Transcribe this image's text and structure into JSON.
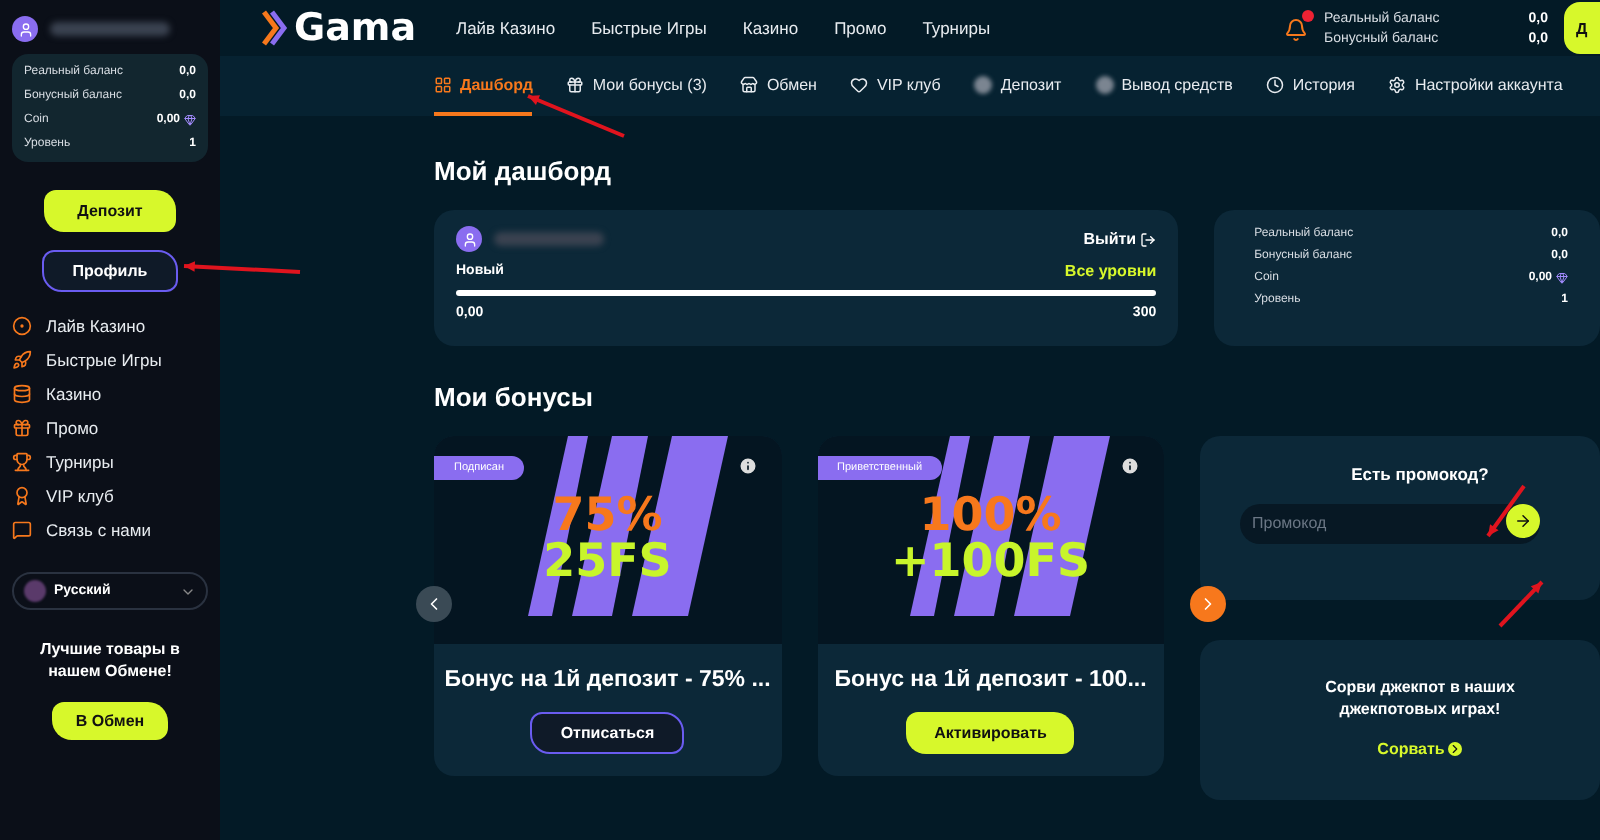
{
  "sidebar": {
    "balances": [
      {
        "label": "Реальный баланс",
        "value": "0,0",
        "gem": false
      },
      {
        "label": "Бонусный баланс",
        "value": "0,0",
        "gem": false
      },
      {
        "label": "Coin",
        "value": "0,00",
        "gem": true
      },
      {
        "label": "Уровень",
        "value": "1",
        "gem": false
      }
    ],
    "deposit_button": "Депозит",
    "profile_button": "Профиль",
    "menu": [
      "Лайв Казино",
      "Быстрые Игры",
      "Казино",
      "Промо",
      "Турниры",
      "VIP клуб",
      "Связь с нами"
    ],
    "language": "Русский",
    "promo_text": "Лучшие товары в нашем Обмене!",
    "exchange_button": "В Обмен"
  },
  "header": {
    "logo": "Gama",
    "links": [
      "Лайв Казино",
      "Быстрые Игры",
      "Казино",
      "Промо",
      "Турниры"
    ],
    "notification": true,
    "balances": [
      {
        "label": "Реальный баланс",
        "value": "0,0"
      },
      {
        "label": "Бонусный баланс",
        "value": "0,0"
      }
    ],
    "button": "Д"
  },
  "tabs": [
    {
      "label": "Дашборд",
      "selected": true
    },
    {
      "label": "Мои бонусы (3)",
      "selected": false
    },
    {
      "label": "Обмен",
      "selected": false
    },
    {
      "label": "VIP клуб",
      "selected": false
    },
    {
      "label": "Депозит",
      "selected": false
    },
    {
      "label": "Вывод средств",
      "selected": false
    },
    {
      "label": "История",
      "selected": false
    },
    {
      "label": "Настройки аккаунта",
      "selected": false
    }
  ],
  "dashboard": {
    "title": "Мой дашборд",
    "logout": "Выйти",
    "level_name": "Новый",
    "all_levels": "Все уровни",
    "progress": {
      "level": 0,
      "from": "0,00",
      "to": "300"
    },
    "balances": [
      {
        "label": "Реальный баланс",
        "value": "0,0",
        "gem": false
      },
      {
        "label": "Бонусный баланс",
        "value": "0,0",
        "gem": false
      },
      {
        "label": "Coin",
        "value": "0,00",
        "gem": true
      },
      {
        "label": "Уровень",
        "value": "1",
        "gem": false
      }
    ]
  },
  "bonuses": {
    "title": "Мои бонусы",
    "cards": [
      {
        "tag": "Подписан",
        "line_1": "75%",
        "line_2": "25FS",
        "title": "Бонус на 1й депозит - 75% ...",
        "button": "Отписаться",
        "kind": "outline"
      },
      {
        "tag": "Приветственный",
        "line_1": "100%",
        "line_2": "+100FS",
        "title": "Бонус на 1й депозит - 100...",
        "button": "Активировать",
        "kind": "filled"
      }
    ]
  },
  "promo": {
    "title": "Есть промокод?",
    "placeholder": "Промокод"
  },
  "jackpot": {
    "text": "Сорви джекпот в наших джекпотовых играх!",
    "link": "Сорвать"
  }
}
